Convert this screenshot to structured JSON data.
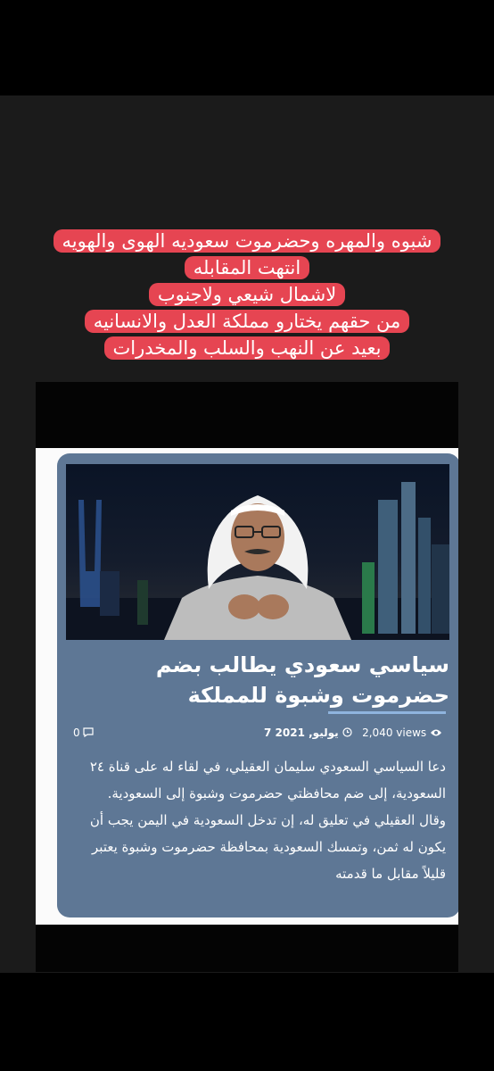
{
  "caption": {
    "lines": [
      "شبوه والمهره وحضرموت سعوديه الهوى والهويه",
      "انتهت المقابله",
      "لاشمال شيعي ولاجنوب",
      "من حقهم يختارو مملكة العدل والانسانيه",
      "بعيد عن النهب والسلب والمخدرات"
    ]
  },
  "article": {
    "headline": "سياسي سعودي يطالب بضم حضرموت وشبوة للمملكة",
    "views": "2,040 views",
    "date": "7 يوليو, 2021",
    "comments": "0",
    "paragraphs": [
      "دعا السياسي السعودي سليمان العقيلي، في لقاء له على قناة ٢٤ السعودية، إلى ضم محافظتي حضرموت وشبوة إلى السعودية.",
      "وقال العقيلي في تعليق له، إن تدخل السعودية في اليمن يجب أن يكون له ثمن، وتمسك السعودية بمحافظة حضرموت وشبوة يعتبر قليلاً مقابل ما قدمته"
    ]
  },
  "colors": {
    "caption_bg": "#e64552",
    "article_bg": "#5e7795",
    "accent_rule": "#8fb4de"
  },
  "icons": {
    "views": "eye-icon",
    "date": "clock-icon",
    "comments": "comment-icon"
  }
}
